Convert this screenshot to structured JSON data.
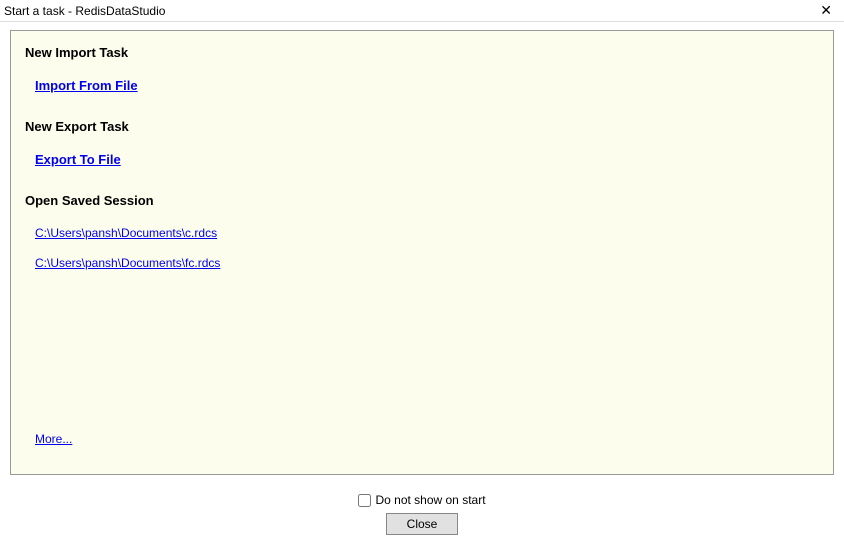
{
  "window": {
    "title": "Start a task - RedisDataStudio"
  },
  "sections": {
    "import": {
      "header": "New Import Task",
      "action": "Import From File"
    },
    "export": {
      "header": "New Export Task",
      "action": "Export To File"
    },
    "sessions": {
      "header": "Open Saved Session",
      "items": [
        "C:\\Users\\pansh\\Documents\\c.rdcs",
        "C:\\Users\\pansh\\Documents\\fc.rdcs"
      ]
    },
    "more": "More..."
  },
  "footer": {
    "checkbox_label": "Do not show on start",
    "close_label": "Close"
  }
}
